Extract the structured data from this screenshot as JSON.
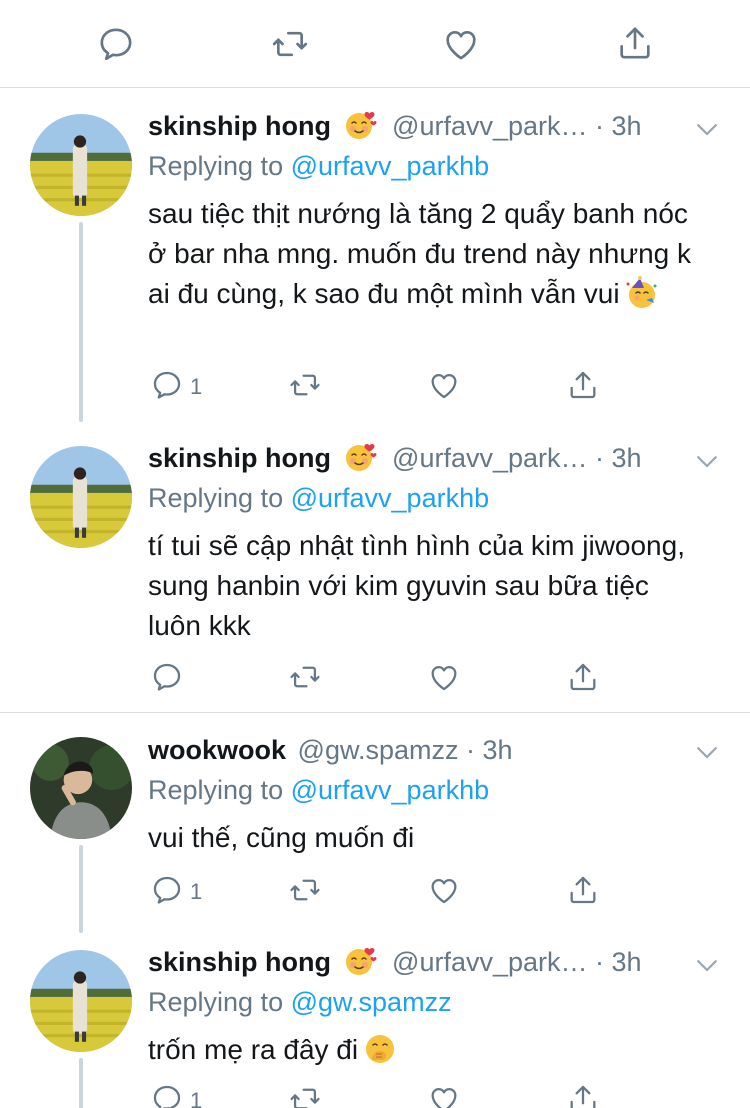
{
  "topbar": {
    "icons": [
      "reply-icon",
      "retweet-icon",
      "like-icon",
      "share-icon"
    ]
  },
  "tweets": [
    {
      "name": "skinship hong",
      "handle": "@urfavv_park… · 3h",
      "replying_prefix": "Replying to",
      "replying_to": "@urfavv_parkhb",
      "text": "sau tiệc thịt nướng là tăng 2 quẩy banh nóc ở bar nha mng. muốn đu trend này nhưng k ai đu cùng, k sao đu một mình vẫn vui",
      "reply_count": "1"
    },
    {
      "name": "skinship hong",
      "handle": "@urfavv_park… · 3h",
      "replying_prefix": "Replying to",
      "replying_to": "@urfavv_parkhb",
      "text": "tí tui sẽ cập nhật tình hình của kim jiwoong, sung hanbin với kim gyuvin sau bữa tiệc luôn kkk",
      "reply_count": ""
    },
    {
      "name": "wookwook",
      "handle": "@gw.spamzz · 3h",
      "replying_prefix": "Replying to",
      "replying_to": "@urfavv_parkhb",
      "text": "vui thế, cũng muốn đi",
      "reply_count": "1"
    },
    {
      "name": "skinship hong",
      "handle": "@urfavv_park… · 3h",
      "replying_prefix": "Replying to",
      "replying_to": "@gw.spamzz",
      "text": "trốn mẹ ra đây đi",
      "reply_count": "1"
    }
  ],
  "colors": {
    "text": "#14171a",
    "secondary": "#657786",
    "accent": "#1da1f2",
    "divider": "#d9dde1"
  }
}
